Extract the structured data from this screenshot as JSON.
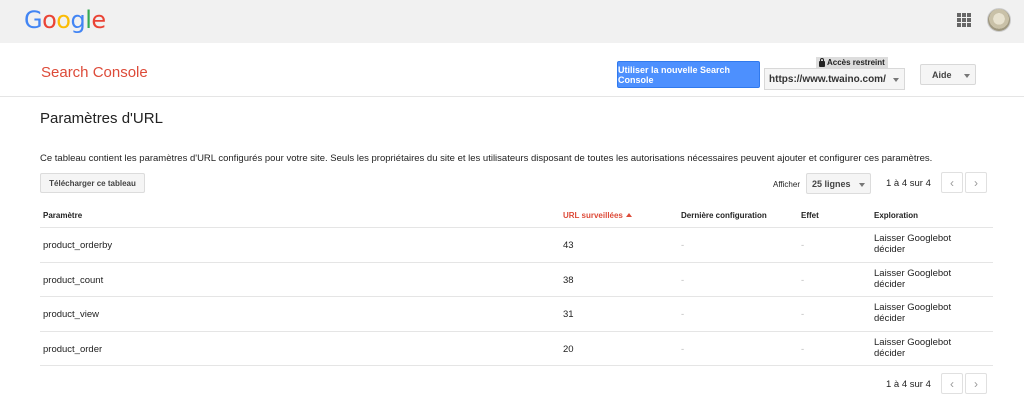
{
  "topbar": {
    "logo_letters": [
      "G",
      "o",
      "o",
      "g",
      "l",
      "e"
    ]
  },
  "header": {
    "product_name": "Search Console",
    "new_sc_button": "Utiliser la nouvelle Search Console",
    "restricted_badge": "Accès restreint",
    "site_url": "https://www.twaino.com/",
    "help_label": "Aide"
  },
  "page": {
    "title": "Paramètres d'URL",
    "description": "Ce tableau contient les paramètres d'URL configurés pour votre site. Seuls les propriétaires du site et les utilisateurs disposant de toutes les autorisations nécessaires peuvent ajouter et configurer ces paramètres.",
    "download_button": "Télécharger ce tableau",
    "show_label": "Afficher",
    "rows_per_page": "25 lignes",
    "pagination_count": "1 à 4 sur 4",
    "prev_glyph": "‹",
    "next_glyph": "›"
  },
  "table": {
    "headers": {
      "parameter": "Paramètre",
      "urls_monitored": "URL surveillées",
      "last_config": "Dernière configuration",
      "effect": "Effet",
      "crawl": "Exploration"
    },
    "rows": [
      {
        "parameter": "product_orderby",
        "urls": "43",
        "last_config": "-",
        "effect": "-",
        "crawl": "Laisser Googlebot décider"
      },
      {
        "parameter": "product_count",
        "urls": "38",
        "last_config": "-",
        "effect": "-",
        "crawl": "Laisser Googlebot décider"
      },
      {
        "parameter": "product_view",
        "urls": "31",
        "last_config": "-",
        "effect": "-",
        "crawl": "Laisser Googlebot décider"
      },
      {
        "parameter": "product_order",
        "urls": "20",
        "last_config": "-",
        "effect": "-",
        "crawl": "Laisser Googlebot décider"
      }
    ]
  }
}
